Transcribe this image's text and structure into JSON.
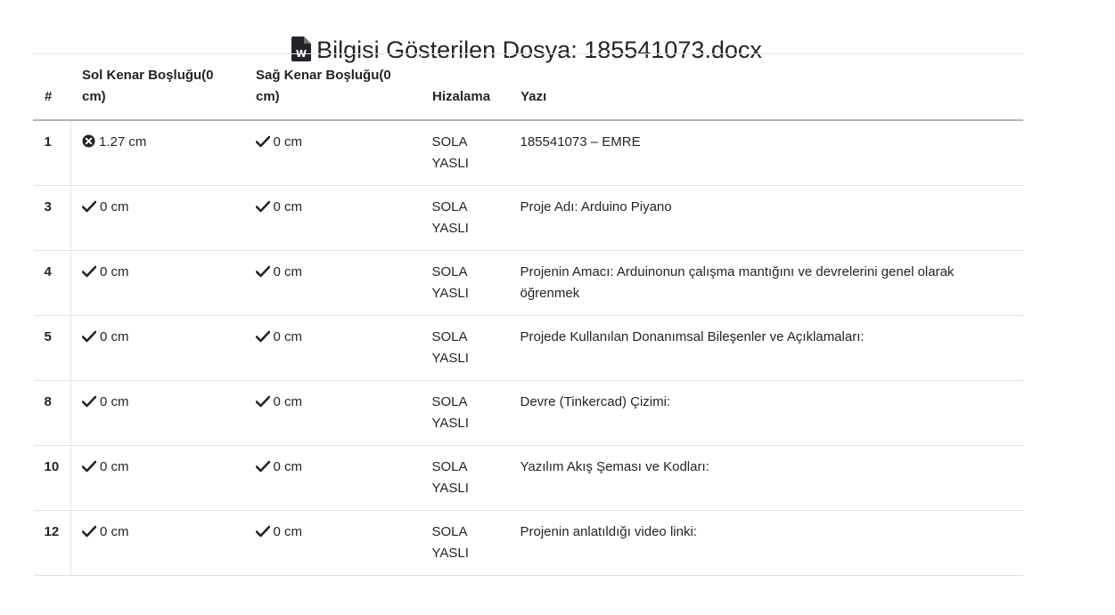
{
  "header": {
    "title": "Bilgisi Gösterilen Dosya: 185541073.docx",
    "icon": "word-file-icon"
  },
  "table": {
    "columns": {
      "num": "#",
      "left_margin": "Sol Kenar Boşluğu(0 cm)",
      "right_margin": "Sağ Kenar Boşluğu(0 cm)",
      "alignment": "Hizalama",
      "text": "Yazı"
    },
    "rows": [
      {
        "num": "1",
        "left": "1.27 cm",
        "left_ok": false,
        "right": "0 cm",
        "right_ok": true,
        "align": "SOLA YASLI",
        "text": "185541073 – EMRE"
      },
      {
        "num": "3",
        "left": "0 cm",
        "left_ok": true,
        "right": "0 cm",
        "right_ok": true,
        "align": "SOLA YASLI",
        "text": "Proje Adı: Arduino Piyano"
      },
      {
        "num": "4",
        "left": "0 cm",
        "left_ok": true,
        "right": "0 cm",
        "right_ok": true,
        "align": "SOLA YASLI",
        "text": "Projenin Amacı: Arduinonun çalışma mantığını ve devrelerini genel olarak öğrenmek"
      },
      {
        "num": "5",
        "left": "0 cm",
        "left_ok": true,
        "right": "0 cm",
        "right_ok": true,
        "align": "SOLA YASLI",
        "text": "Projede Kullanılan Donanımsal Bileşenler ve Açıklamaları:"
      },
      {
        "num": "8",
        "left": "0 cm",
        "left_ok": true,
        "right": "0 cm",
        "right_ok": true,
        "align": "SOLA YASLI",
        "text": "Devre (Tinkercad) Çizimi:"
      },
      {
        "num": "10",
        "left": "0 cm",
        "left_ok": true,
        "right": "0 cm",
        "right_ok": true,
        "align": "SOLA YASLI",
        "text": "Yazılım Akış Şeması ve Kodları:"
      },
      {
        "num": "12",
        "left": "0 cm",
        "left_ok": true,
        "right": "0 cm",
        "right_ok": true,
        "align": "SOLA YASLI",
        "text": "Projenin anlatıldığı video linki:"
      }
    ]
  },
  "icons": {
    "ok": "check-icon",
    "error": "times-circle-icon"
  }
}
